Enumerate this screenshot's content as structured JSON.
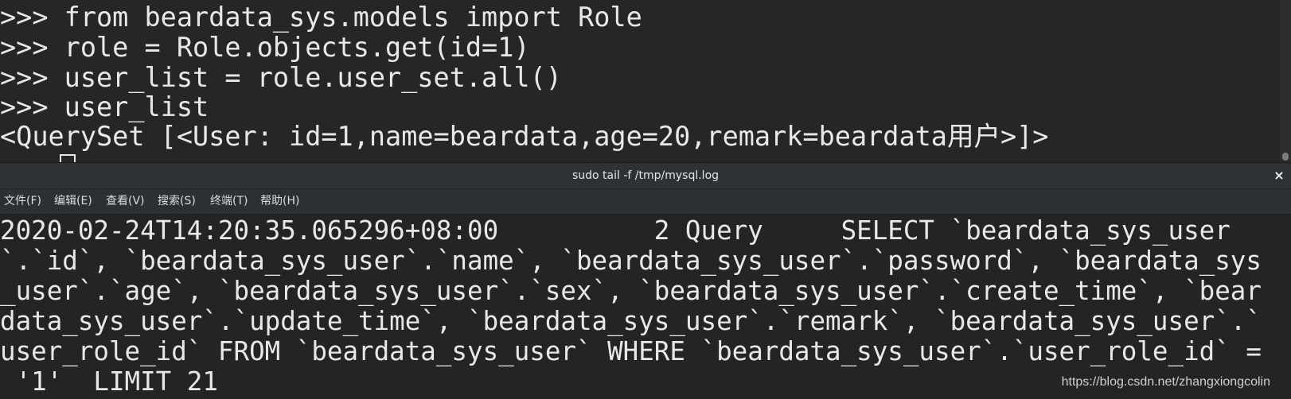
{
  "top_terminal": {
    "lines": [
      ">>> from beardata_sys.models import Role",
      ">>> role = Role.objects.get(id=1)",
      ">>> user_list = role.user_set.all()",
      ">>> user_list",
      "<QuerySet [<User: id=1,name=beardata,age=20,remark=beardata用户>]>"
    ]
  },
  "window": {
    "title": "sudo tail -f /tmp/mysql.log",
    "close_label": "×"
  },
  "menu": {
    "items": [
      "文件(F)",
      "编辑(E)",
      "查看(V)",
      "搜索(S)",
      "终端(T)",
      "帮助(H)"
    ]
  },
  "log": {
    "lines": [
      "2020-02-24T14:20:35.065296+08:00          2 Query     SELECT `beardata_sys_user",
      "`.`id`, `beardata_sys_user`.`name`, `beardata_sys_user`.`password`, `beardata_sys",
      "_user`.`age`, `beardata_sys_user`.`sex`, `beardata_sys_user`.`create_time`, `bear",
      "data_sys_user`.`update_time`, `beardata_sys_user`.`remark`, `beardata_sys_user`.`",
      "user_role_id` FROM `beardata_sys_user` WHERE `beardata_sys_user`.`user_role_id` =",
      " '1'  LIMIT 21"
    ]
  },
  "watermark": "https://blog.csdn.net/zhangxiongcolin",
  "colors": {
    "terminal_bg": "#242628",
    "terminal_fg": "#e8e8e8",
    "titlebar_bg": "#2f3234",
    "menubar_bg": "#2d3033"
  }
}
